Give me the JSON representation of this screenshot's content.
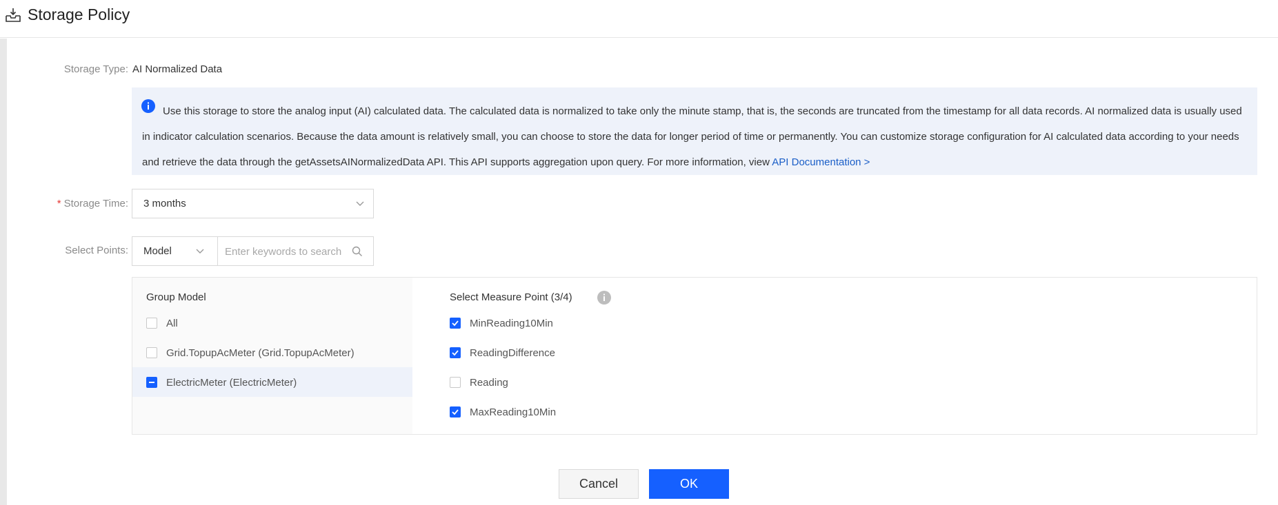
{
  "header": {
    "title": "Storage Policy",
    "icon": "storage-tray-icon"
  },
  "storage_type": {
    "label": "Storage Type:",
    "value": "AI Normalized Data"
  },
  "info": {
    "text": "Use this storage to store the analog input (AI) calculated data. The calculated data is normalized to take only the minute stamp, that is, the seconds are truncated from the timestamp for all data records. AI normalized data is usually used in indicator calculation scenarios. Because the data amount is relatively small, you can choose to store the data for longer period of time or permanently. You can customize storage configuration for AI calculated data according to your needs and retrieve the data through the getAssetsAINormalizedData API. This API supports aggregation upon query. For more information, view ",
    "link": "API Documentation >",
    "icon": "info-circle-icon"
  },
  "storage_time": {
    "required_mark": "*",
    "label": "Storage Time:",
    "value": "3 months"
  },
  "select_points": {
    "label": "Select Points:",
    "filter_type": "Model",
    "search_placeholder": "Enter keywords to search"
  },
  "group_model": {
    "title": "Group Model",
    "items": [
      {
        "label": "All",
        "state": "unchecked"
      },
      {
        "label": "Grid.TopupAcMeter (Grid.TopupAcMeter)",
        "state": "unchecked"
      },
      {
        "label": "ElectricMeter (ElectricMeter)",
        "state": "partial"
      }
    ]
  },
  "measure_points": {
    "title": "Select Measure Point (3/4)",
    "items": [
      {
        "label": "MinReading10Min",
        "state": "checked"
      },
      {
        "label": "ReadingDifference",
        "state": "checked"
      },
      {
        "label": "Reading",
        "state": "unchecked"
      },
      {
        "label": "MaxReading10Min",
        "state": "checked"
      }
    ]
  },
  "buttons": {
    "cancel": "Cancel",
    "ok": "OK"
  },
  "colors": {
    "primary": "#1560ff",
    "link": "#1a5ec7",
    "info_bg": "#eef2fa",
    "required": "#e53935"
  }
}
